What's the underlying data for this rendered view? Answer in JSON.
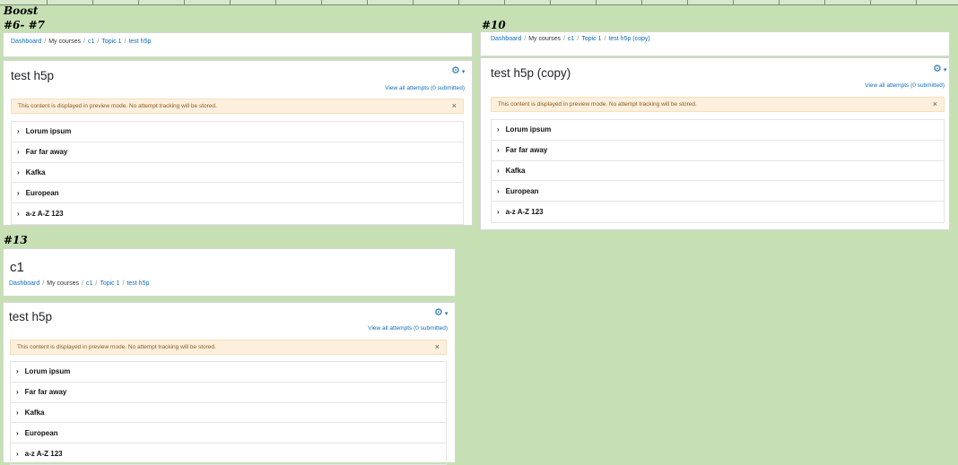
{
  "header_label": "Boost",
  "sections": {
    "s1": {
      "label": "#6- #7",
      "breadcrumb": [
        "Dashboard",
        "My courses",
        "c1",
        "Topic 1",
        "test h5p"
      ],
      "title": "test h5p",
      "attempts_link": "View all attempts (0 submitted)",
      "alert": "This content is displayed in preview mode. No attempt tracking will be stored.",
      "items": [
        "Lorum ipsum",
        "Far far away",
        "Kafka",
        "European",
        "a-z A-Z 123"
      ]
    },
    "s2": {
      "label": "#10",
      "breadcrumb": [
        "Dashboard",
        "My courses",
        "c1",
        "Topic 1",
        "test h5p (copy)"
      ],
      "title": "test h5p (copy)",
      "attempts_link": "View all attempts (0 submitted)",
      "alert": "This content is displayed in preview mode. No attempt tracking will be stored.",
      "items": [
        "Lorum ipsum",
        "Far far away",
        "Kafka",
        "European",
        "a-z A-Z 123"
      ]
    },
    "s3": {
      "label": "#13",
      "course_title": "c1",
      "breadcrumb": [
        "Dashboard",
        "My courses",
        "c1",
        "Topic 1",
        "test h5p"
      ],
      "title": "test h5p",
      "attempts_link": "View all attempts (0 submitted)",
      "alert": "This content is displayed in preview mode. No attempt tracking will be stored.",
      "items": [
        "Lorum ipsum",
        "Far far away",
        "Kafka",
        "European",
        "a-z A-Z 123"
      ]
    }
  },
  "common": {
    "gear_icon": "gear-icon",
    "caret_icon": "caret-down-icon",
    "close_glyph": "×",
    "chevron_glyph": "›",
    "gear_glyph": "⚙",
    "caret_glyph": "▾",
    "breadcrumb_sep": "/"
  },
  "colors": {
    "background": "#c6e0b4",
    "link": "#0f6cbf",
    "alert_bg": "#fcefdc",
    "alert_text": "#8a5a22"
  }
}
